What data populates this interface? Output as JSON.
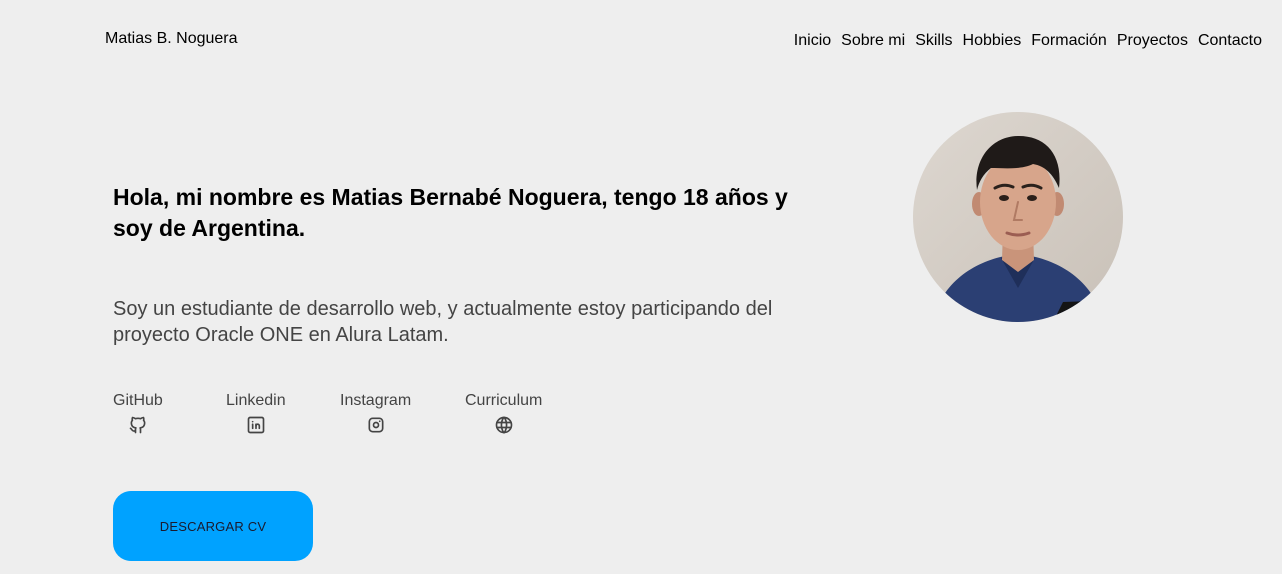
{
  "header": {
    "brand": "Matias B. Noguera",
    "nav": [
      "Inicio",
      "Sobre mi",
      "Skills",
      "Hobbies",
      "Formación",
      "Proyectos",
      "Contacto"
    ]
  },
  "hero": {
    "intro": "Hola, mi nombre es Matias Bernabé Noguera, tengo 18 años y soy de Argentina.",
    "description": "Soy un estudiante de desarrollo web, y actualmente estoy participando del proyecto Oracle ONE en Alura Latam.",
    "socials": [
      {
        "label": "GitHub",
        "icon": "github-icon"
      },
      {
        "label": "Linkedin",
        "icon": "linkedin-icon"
      },
      {
        "label": "Instagram",
        "icon": "instagram-icon"
      },
      {
        "label": "Curriculum",
        "icon": "globe-icon"
      }
    ],
    "cv_button": "DESCARGAR CV"
  },
  "colors": {
    "background": "#eeeeee",
    "button": "#00a2ff",
    "text": "#000000",
    "muted_text": "#444444"
  }
}
